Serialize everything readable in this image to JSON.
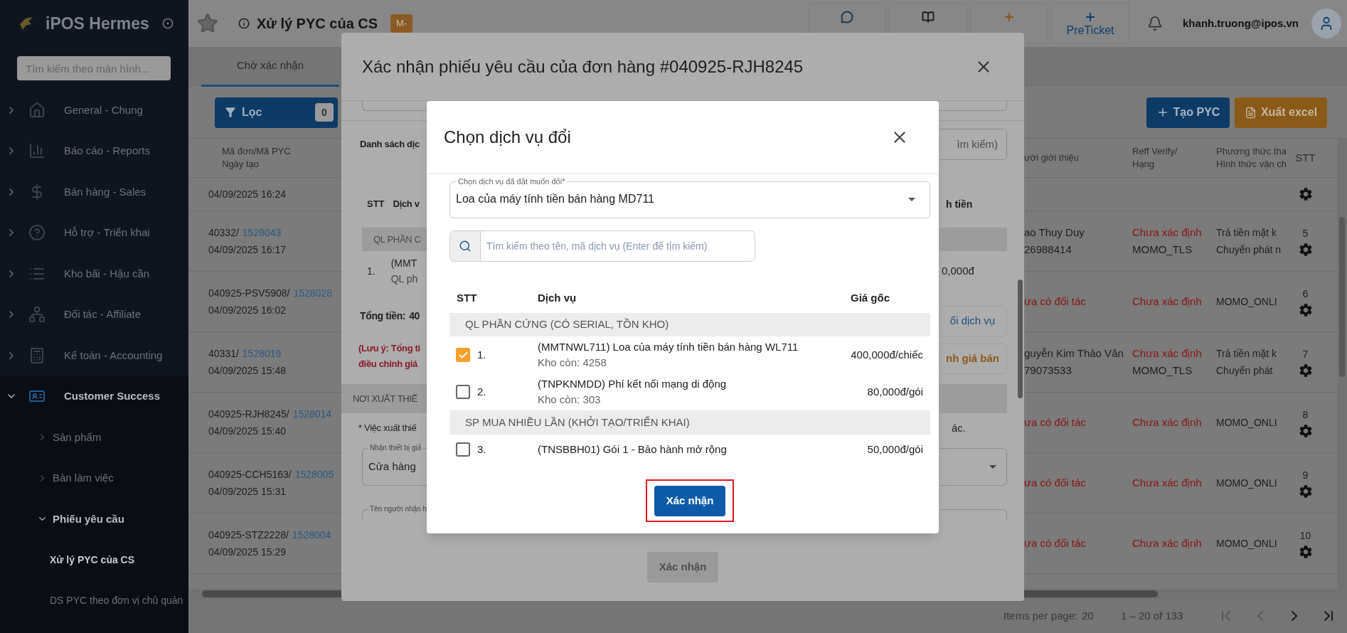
{
  "sidebar": {
    "logo_text": "iPOS Hermes",
    "search": {
      "placeholder": "Tìm kiếm theo màn hình..."
    },
    "items": [
      {
        "label": "General - Chung",
        "expanded": false
      },
      {
        "label": "Báo cáo - Reports",
        "expanded": false
      },
      {
        "label": "Bán hàng - Sales",
        "expanded": false
      },
      {
        "label": "Hỗ trợ - Triển khai",
        "expanded": false
      },
      {
        "label": "Kho bãi - Hậu cần",
        "expanded": false
      },
      {
        "label": "Đối tác - Affiliate",
        "expanded": false
      },
      {
        "label": "Kế toán - Accounting",
        "expanded": false
      },
      {
        "label": "Customer Success",
        "expanded": true,
        "children": [
          {
            "label": "Sản phẩm",
            "expanded": false
          },
          {
            "label": "Bàn làm việc",
            "expanded": false
          },
          {
            "label": "Phiếu yêu cầu",
            "expanded": true,
            "children": [
              {
                "label": "Xử lý PYC của CS",
                "selected": true
              },
              {
                "label": "DS PYC theo đơn vị chủ quản",
                "selected": false
              }
            ]
          }
        ]
      }
    ]
  },
  "header": {
    "title": "Xử lý PYC của CS",
    "badge": "M-",
    "actions": [
      {
        "color": "#1c3550"
      },
      {
        "color": "#1e1e1e"
      },
      {
        "color": "#8a5618"
      },
      {
        "label": "PreTicket",
        "color": "#0d3f6e"
      }
    ],
    "user_email": "khanh.truong@ipos.vn"
  },
  "tabs": [
    {
      "label": "Chờ xác nhận",
      "selected": true
    }
  ],
  "toolbar": {
    "filter": {
      "label": "Lọc",
      "count": "0"
    },
    "buttons": [
      {
        "label": "Tạo PYC",
        "kind": "create"
      },
      {
        "label": "Xuất excel",
        "kind": "export"
      }
    ]
  },
  "table": {
    "columns": [
      {
        "lines": [
          "Mã đơn/Mã PYC",
          "Ngày tạo"
        ]
      },
      {
        "lines": [
          "ười giới thiệu"
        ]
      },
      {
        "lines": [
          "Reff Verify/",
          "Hạng"
        ]
      },
      {
        "lines": [
          "Phương thức tha",
          "Hình thức vận ch"
        ]
      },
      {
        "lines": [
          "STT"
        ]
      }
    ],
    "rows": [
      {
        "date": "04/09/2025 16:24"
      },
      {
        "order": "40332/",
        "request_id": "1528043",
        "date": "04/09/2025 16:17",
        "referrer": "ao Thuy Duy",
        "referrer_phone": "26988414",
        "referrer_known": true,
        "verify": "Chưa xác định",
        "rank": "MOMO_TLS",
        "payment": "Trả tiền mặt k",
        "shipping": "Chuyển phát n",
        "stt": "5"
      },
      {
        "order": "040925-PSV5908/",
        "request_id": "1528028",
        "date": "04/09/2025 16:02",
        "referrer": "ưa có đối tác",
        "referrer_known": false,
        "verify": "Chưa xác định",
        "payment": "MOMO_ONLI",
        "stt": "6"
      },
      {
        "order": "40331/",
        "request_id": "1528019",
        "date": "04/09/2025 15:48",
        "referrer": "guyễn Kim Thảo Vân",
        "referrer_phone": "79073533",
        "referrer_known": true,
        "verify": "Chưa xác định",
        "rank": "MOMO_TLS",
        "payment": "Trả tiền mặt k",
        "shipping": "Chuyển phát",
        "stt": "7"
      },
      {
        "order": "040925-RJH8245/",
        "request_id": "1528014",
        "date": "04/09/2025 15:40",
        "referrer": "ưa có đối tác",
        "referrer_known": false,
        "verify": "Chưa xác định",
        "payment": "MOMO_ONLI",
        "stt": "8"
      },
      {
        "order": "040925-CCH5163/",
        "request_id": "1528005",
        "date": "04/09/2025 15:31",
        "referrer": "ưa có đối tác",
        "referrer_known": false,
        "verify": "Chưa xác định",
        "payment": "MOMO_ONLI",
        "stt": "9"
      },
      {
        "order": "040925-STZ2228/",
        "request_id": "1528004",
        "date": "04/09/2025 15:29",
        "referrer": "ưa có đối tác",
        "referrer_known": false,
        "verify": "Chưa xác định",
        "payment": "MOMO_ONLI",
        "stt": "10"
      }
    ]
  },
  "pagination": {
    "items_per_page_label": "Items per page:",
    "items_per_page": "20",
    "range": "1 – 20 of 133"
  },
  "confirm_dialog": {
    "title": "Xác nhận phiếu yêu cầu của đơn hàng #040925-RJH8245",
    "left": {
      "section_title": "Danh sách dịc",
      "col_stt": "STT",
      "col_service": "Dịch v",
      "group": "QL PHẦN C",
      "row_index": "1.",
      "row_line1": "(MMT",
      "row_line2": "QL ph",
      "total_label": "Tổng tiền:",
      "total_value": "40",
      "note_lines": [
        "(Lưu ý: Tổng ti",
        "điều chỉnh giá"
      ],
      "section_band": "NƠI XUẤT THIẾ",
      "instruction": "* Việc xuất thiế",
      "field1_label": "Nhận thiết bị giấ",
      "field1_value": "Cửa hàng",
      "field2_label": "Tên người nhận h"
    },
    "right": {
      "search_button": "ìm kiếm)",
      "col_amount": "h tiền",
      "row_amount": "0,000đ",
      "change_button": "ổi dịch vụ",
      "price_button": "nh giá bán",
      "instruction_end": "ác."
    },
    "confirm_label": "Xác nhận",
    "confirm_disabled": true
  },
  "service_dialog": {
    "title": "Chọn dịch vụ đổi",
    "select": {
      "label": "Chọn dịch vụ đã đặt muốn đổi*",
      "value": "Loa của máy tính tiền bán hàng MD711"
    },
    "search": {
      "placeholder": "Tìm kiếm theo tên, mã dịch vụ (Enter để tìm kiếm)"
    },
    "columns": [
      "STT",
      "Dịch vụ",
      "Giá gốc"
    ],
    "groups": [
      {
        "name": "QL PHẦN CỨNG (CÓ SERIAL, TỒN KHO)",
        "items": [
          {
            "index": "1.",
            "name": "(MMTNWL711) Loa của máy tính tiền bán hàng WL711",
            "stock": "Kho còn: 4258",
            "price": "400,000đ/chiếc",
            "checked": true
          },
          {
            "index": "2.",
            "name": "(TNPKNMDD) Phí kết nối mạng di động",
            "stock": "Kho còn: 303",
            "price": "80,000đ/gói",
            "checked": false
          }
        ]
      },
      {
        "name": "SP MUA NHIỀU LẦN (KHỞI TẠO/TRIỂN KHAI)",
        "items": [
          {
            "index": "3.",
            "name": "(TNSBBH01) Gói 1 - Bảo hành mở rộng",
            "price": "50,000đ/gói",
            "checked": false
          }
        ]
      }
    ],
    "confirm_label": "Xác nhận",
    "confirm_highlighted": true
  }
}
